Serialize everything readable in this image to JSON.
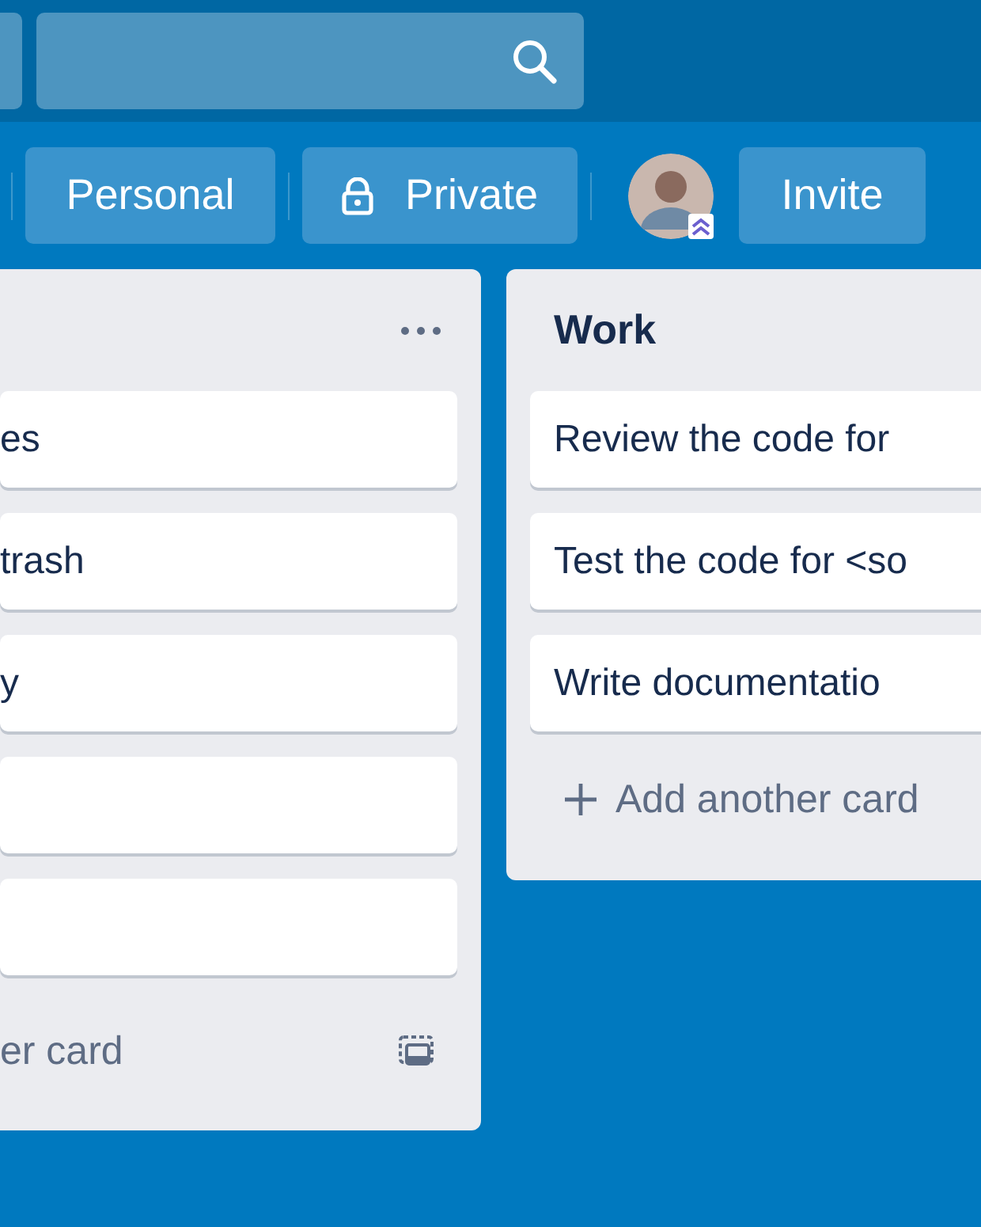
{
  "header": {
    "team": "Personal",
    "visibility": "Private",
    "invite": "Invite"
  },
  "lists": [
    {
      "cards": [
        {
          "kind": "text",
          "text": "es"
        },
        {
          "kind": "text",
          "text": "trash"
        },
        {
          "kind": "text",
          "text": "y"
        },
        {
          "kind": "blank"
        },
        {
          "kind": "blank"
        }
      ],
      "add_card": "er card",
      "menu": true,
      "template": true
    },
    {
      "title": "Work",
      "cards": [
        {
          "kind": "text",
          "text": "Review the code for"
        },
        {
          "kind": "text",
          "text": "Test the code for <so"
        },
        {
          "kind": "text",
          "text": "Write documentatio"
        }
      ],
      "add_card": "Add another card",
      "menu": false,
      "template": false
    }
  ]
}
